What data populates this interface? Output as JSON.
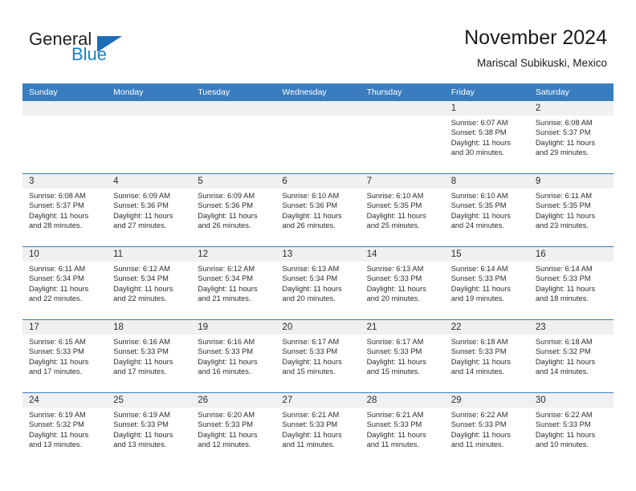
{
  "brand": {
    "name_part1": "General",
    "name_part2": "Blue",
    "accent_color": "#1b7fc4",
    "header_blue": "#3a7dbf"
  },
  "header": {
    "title": "November 2024",
    "subtitle": "Mariscal Subikuski, Mexico"
  },
  "weekday_headers": [
    "Sunday",
    "Monday",
    "Tuesday",
    "Wednesday",
    "Thursday",
    "Friday",
    "Saturday"
  ],
  "weeks": [
    [
      {
        "day": "",
        "sunrise": "",
        "sunset": "",
        "daylight_line1": "",
        "daylight_line2": "",
        "empty": true
      },
      {
        "day": "",
        "sunrise": "",
        "sunset": "",
        "daylight_line1": "",
        "daylight_line2": "",
        "empty": true
      },
      {
        "day": "",
        "sunrise": "",
        "sunset": "",
        "daylight_line1": "",
        "daylight_line2": "",
        "empty": true
      },
      {
        "day": "",
        "sunrise": "",
        "sunset": "",
        "daylight_line1": "",
        "daylight_line2": "",
        "empty": true
      },
      {
        "day": "",
        "sunrise": "",
        "sunset": "",
        "daylight_line1": "",
        "daylight_line2": "",
        "empty": true
      },
      {
        "day": "1",
        "sunrise": "Sunrise: 6:07 AM",
        "sunset": "Sunset: 5:38 PM",
        "daylight_line1": "Daylight: 11 hours",
        "daylight_line2": "and 30 minutes."
      },
      {
        "day": "2",
        "sunrise": "Sunrise: 6:08 AM",
        "sunset": "Sunset: 5:37 PM",
        "daylight_line1": "Daylight: 11 hours",
        "daylight_line2": "and 29 minutes."
      }
    ],
    [
      {
        "day": "3",
        "sunrise": "Sunrise: 6:08 AM",
        "sunset": "Sunset: 5:37 PM",
        "daylight_line1": "Daylight: 11 hours",
        "daylight_line2": "and 28 minutes."
      },
      {
        "day": "4",
        "sunrise": "Sunrise: 6:09 AM",
        "sunset": "Sunset: 5:36 PM",
        "daylight_line1": "Daylight: 11 hours",
        "daylight_line2": "and 27 minutes."
      },
      {
        "day": "5",
        "sunrise": "Sunrise: 6:09 AM",
        "sunset": "Sunset: 5:36 PM",
        "daylight_line1": "Daylight: 11 hours",
        "daylight_line2": "and 26 minutes."
      },
      {
        "day": "6",
        "sunrise": "Sunrise: 6:10 AM",
        "sunset": "Sunset: 5:36 PM",
        "daylight_line1": "Daylight: 11 hours",
        "daylight_line2": "and 26 minutes."
      },
      {
        "day": "7",
        "sunrise": "Sunrise: 6:10 AM",
        "sunset": "Sunset: 5:35 PM",
        "daylight_line1": "Daylight: 11 hours",
        "daylight_line2": "and 25 minutes."
      },
      {
        "day": "8",
        "sunrise": "Sunrise: 6:10 AM",
        "sunset": "Sunset: 5:35 PM",
        "daylight_line1": "Daylight: 11 hours",
        "daylight_line2": "and 24 minutes."
      },
      {
        "day": "9",
        "sunrise": "Sunrise: 6:11 AM",
        "sunset": "Sunset: 5:35 PM",
        "daylight_line1": "Daylight: 11 hours",
        "daylight_line2": "and 23 minutes."
      }
    ],
    [
      {
        "day": "10",
        "sunrise": "Sunrise: 6:11 AM",
        "sunset": "Sunset: 5:34 PM",
        "daylight_line1": "Daylight: 11 hours",
        "daylight_line2": "and 22 minutes."
      },
      {
        "day": "11",
        "sunrise": "Sunrise: 6:12 AM",
        "sunset": "Sunset: 5:34 PM",
        "daylight_line1": "Daylight: 11 hours",
        "daylight_line2": "and 22 minutes."
      },
      {
        "day": "12",
        "sunrise": "Sunrise: 6:12 AM",
        "sunset": "Sunset: 5:34 PM",
        "daylight_line1": "Daylight: 11 hours",
        "daylight_line2": "and 21 minutes."
      },
      {
        "day": "13",
        "sunrise": "Sunrise: 6:13 AM",
        "sunset": "Sunset: 5:34 PM",
        "daylight_line1": "Daylight: 11 hours",
        "daylight_line2": "and 20 minutes."
      },
      {
        "day": "14",
        "sunrise": "Sunrise: 6:13 AM",
        "sunset": "Sunset: 5:33 PM",
        "daylight_line1": "Daylight: 11 hours",
        "daylight_line2": "and 20 minutes."
      },
      {
        "day": "15",
        "sunrise": "Sunrise: 6:14 AM",
        "sunset": "Sunset: 5:33 PM",
        "daylight_line1": "Daylight: 11 hours",
        "daylight_line2": "and 19 minutes."
      },
      {
        "day": "16",
        "sunrise": "Sunrise: 6:14 AM",
        "sunset": "Sunset: 5:33 PM",
        "daylight_line1": "Daylight: 11 hours",
        "daylight_line2": "and 18 minutes."
      }
    ],
    [
      {
        "day": "17",
        "sunrise": "Sunrise: 6:15 AM",
        "sunset": "Sunset: 5:33 PM",
        "daylight_line1": "Daylight: 11 hours",
        "daylight_line2": "and 17 minutes."
      },
      {
        "day": "18",
        "sunrise": "Sunrise: 6:16 AM",
        "sunset": "Sunset: 5:33 PM",
        "daylight_line1": "Daylight: 11 hours",
        "daylight_line2": "and 17 minutes."
      },
      {
        "day": "19",
        "sunrise": "Sunrise: 6:16 AM",
        "sunset": "Sunset: 5:33 PM",
        "daylight_line1": "Daylight: 11 hours",
        "daylight_line2": "and 16 minutes."
      },
      {
        "day": "20",
        "sunrise": "Sunrise: 6:17 AM",
        "sunset": "Sunset: 5:33 PM",
        "daylight_line1": "Daylight: 11 hours",
        "daylight_line2": "and 15 minutes."
      },
      {
        "day": "21",
        "sunrise": "Sunrise: 6:17 AM",
        "sunset": "Sunset: 5:33 PM",
        "daylight_line1": "Daylight: 11 hours",
        "daylight_line2": "and 15 minutes."
      },
      {
        "day": "22",
        "sunrise": "Sunrise: 6:18 AM",
        "sunset": "Sunset: 5:33 PM",
        "daylight_line1": "Daylight: 11 hours",
        "daylight_line2": "and 14 minutes."
      },
      {
        "day": "23",
        "sunrise": "Sunrise: 6:18 AM",
        "sunset": "Sunset: 5:32 PM",
        "daylight_line1": "Daylight: 11 hours",
        "daylight_line2": "and 14 minutes."
      }
    ],
    [
      {
        "day": "24",
        "sunrise": "Sunrise: 6:19 AM",
        "sunset": "Sunset: 5:32 PM",
        "daylight_line1": "Daylight: 11 hours",
        "daylight_line2": "and 13 minutes."
      },
      {
        "day": "25",
        "sunrise": "Sunrise: 6:19 AM",
        "sunset": "Sunset: 5:33 PM",
        "daylight_line1": "Daylight: 11 hours",
        "daylight_line2": "and 13 minutes."
      },
      {
        "day": "26",
        "sunrise": "Sunrise: 6:20 AM",
        "sunset": "Sunset: 5:33 PM",
        "daylight_line1": "Daylight: 11 hours",
        "daylight_line2": "and 12 minutes."
      },
      {
        "day": "27",
        "sunrise": "Sunrise: 6:21 AM",
        "sunset": "Sunset: 5:33 PM",
        "daylight_line1": "Daylight: 11 hours",
        "daylight_line2": "and 11 minutes."
      },
      {
        "day": "28",
        "sunrise": "Sunrise: 6:21 AM",
        "sunset": "Sunset: 5:33 PM",
        "daylight_line1": "Daylight: 11 hours",
        "daylight_line2": "and 11 minutes."
      },
      {
        "day": "29",
        "sunrise": "Sunrise: 6:22 AM",
        "sunset": "Sunset: 5:33 PM",
        "daylight_line1": "Daylight: 11 hours",
        "daylight_line2": "and 11 minutes."
      },
      {
        "day": "30",
        "sunrise": "Sunrise: 6:22 AM",
        "sunset": "Sunset: 5:33 PM",
        "daylight_line1": "Daylight: 11 hours",
        "daylight_line2": "and 10 minutes."
      }
    ]
  ]
}
